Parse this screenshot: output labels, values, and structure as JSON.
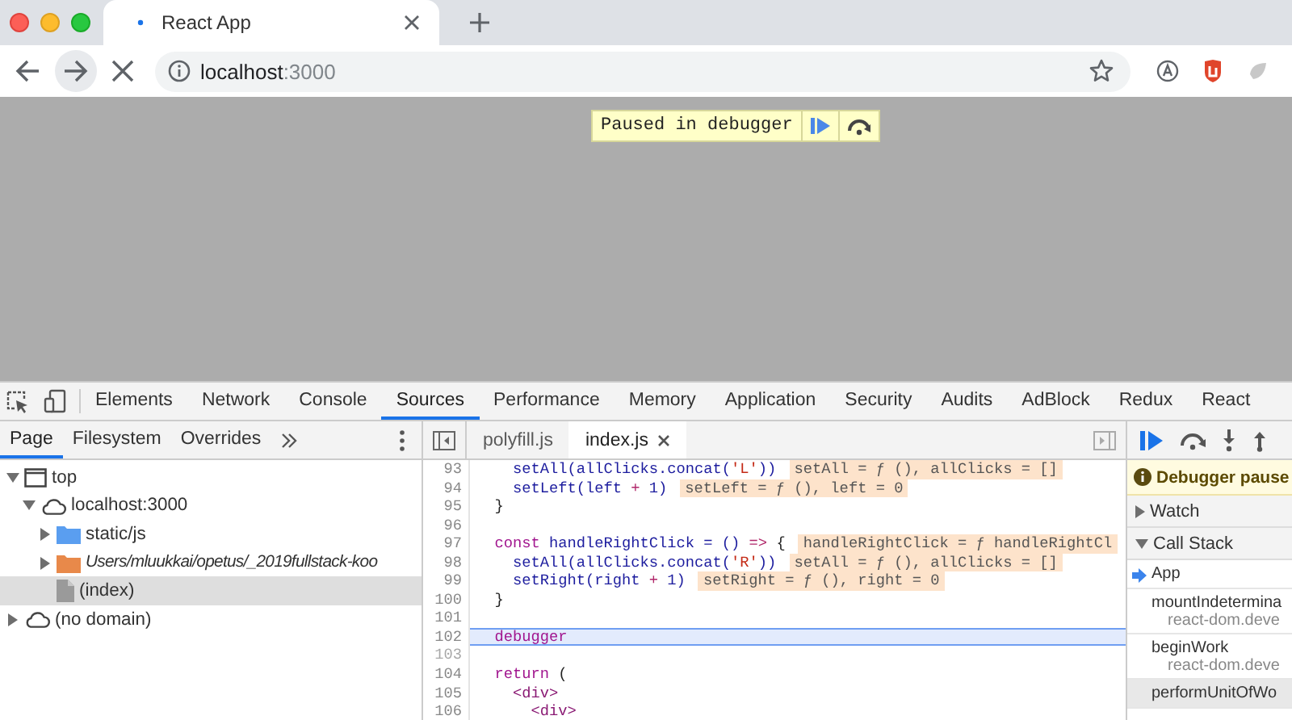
{
  "browser": {
    "tab": {
      "title": "React App"
    },
    "loading": true,
    "address": {
      "host": "localhost",
      "port": ":3000"
    }
  },
  "page": {
    "paused_banner": "Paused in debugger"
  },
  "devtools": {
    "tabs": [
      {
        "label": "Elements",
        "selected": false
      },
      {
        "label": "Network",
        "selected": false
      },
      {
        "label": "Console",
        "selected": false
      },
      {
        "label": "Sources",
        "selected": true
      },
      {
        "label": "Performance",
        "selected": false
      },
      {
        "label": "Memory",
        "selected": false
      },
      {
        "label": "Application",
        "selected": false
      },
      {
        "label": "Security",
        "selected": false
      },
      {
        "label": "Audits",
        "selected": false
      },
      {
        "label": "AdBlock",
        "selected": false
      },
      {
        "label": "Redux",
        "selected": false
      },
      {
        "label": "React",
        "selected": false
      }
    ],
    "navigator": {
      "tabs": [
        {
          "label": "Page",
          "selected": true
        },
        {
          "label": "Filesystem",
          "selected": false
        },
        {
          "label": "Overrides",
          "selected": false
        }
      ],
      "tree": [
        {
          "label": "top",
          "kind": "frame",
          "expanded": true,
          "italic": false,
          "selected": false,
          "children": [
            {
              "label": "localhost:3000",
              "kind": "domain",
              "expanded": true,
              "italic": false,
              "selected": false,
              "children": [
                {
                  "label": "static/js",
                  "kind": "folder",
                  "color": "#5a9ef0",
                  "expanded": false,
                  "italic": false,
                  "selected": false
                },
                {
                  "label": "Users/mluukkai/opetus/_2019fullstack-koo",
                  "kind": "folder",
                  "color": "#e8894a",
                  "expanded": false,
                  "italic": true,
                  "selected": false
                },
                {
                  "label": "(index)",
                  "kind": "file",
                  "italic": false,
                  "selected": true
                }
              ]
            }
          ]
        },
        {
          "label": "(no domain)",
          "kind": "domain",
          "expanded": false,
          "italic": false,
          "selected": false
        }
      ]
    },
    "editor": {
      "tabs": [
        {
          "label": "polyfill.js",
          "selected": false,
          "closable": false
        },
        {
          "label": "index.js",
          "selected": true,
          "closable": true
        }
      ],
      "lines": [
        {
          "number": "93",
          "executable": true,
          "current": false,
          "tokens": [
            {
              "text": "    setAll(allClicks.concat(",
              "kind": "plain"
            },
            {
              "text": "'L'",
              "kind": "string"
            },
            {
              "text": "))",
              "kind": "plain"
            }
          ],
          "value": "setAll = ƒ (), allClicks = []"
        },
        {
          "number": "94",
          "executable": true,
          "current": false,
          "tokens": [
            {
              "text": "    setLeft(left ",
              "kind": "plain"
            },
            {
              "text": "+",
              "kind": "operator"
            },
            {
              "text": " 1)",
              "kind": "plain"
            }
          ],
          "value": "setLeft = ƒ (), left = 0"
        },
        {
          "number": "95",
          "executable": true,
          "current": false,
          "tokens": [
            {
              "text": "  }",
              "kind": "punct"
            }
          ]
        },
        {
          "number": "96",
          "executable": true,
          "current": false
        },
        {
          "number": "97",
          "executable": true,
          "current": false,
          "tokens": [
            {
              "text": "  const",
              "kind": "keyword"
            },
            {
              "text": " handleRightClick = () ",
              "kind": "plain"
            },
            {
              "text": "=>",
              "kind": "operator"
            },
            {
              "text": " {",
              "kind": "punct"
            }
          ],
          "value": "handleRightClick = ƒ handleRightCl"
        },
        {
          "number": "98",
          "executable": true,
          "current": false,
          "tokens": [
            {
              "text": "    setAll(allClicks.concat(",
              "kind": "plain"
            },
            {
              "text": "'R'",
              "kind": "string"
            },
            {
              "text": "))",
              "kind": "plain"
            }
          ],
          "value": "setAll = ƒ (), allClicks = []"
        },
        {
          "number": "99",
          "executable": true,
          "current": false,
          "tokens": [
            {
              "text": "    setRight(right ",
              "kind": "plain"
            },
            {
              "text": "+",
              "kind": "operator"
            },
            {
              "text": " 1)",
              "kind": "plain"
            }
          ],
          "value": "setRight = ƒ (), right = 0"
        },
        {
          "number": "100",
          "executable": true,
          "current": false,
          "tokens": [
            {
              "text": "  }",
              "kind": "punct"
            }
          ]
        },
        {
          "number": "101",
          "executable": true,
          "current": false
        },
        {
          "number": "102",
          "executable": true,
          "current": true,
          "tokens": [
            {
              "text": "  debugger",
              "kind": "keyword"
            }
          ]
        },
        {
          "number": "103",
          "executable": false,
          "current": false
        },
        {
          "number": "104",
          "executable": true,
          "current": false,
          "tokens": [
            {
              "text": "  return",
              "kind": "keyword"
            },
            {
              "text": " (",
              "kind": "punct"
            }
          ]
        },
        {
          "number": "105",
          "executable": true,
          "current": false,
          "tokens": [
            {
              "text": "    <div>",
              "kind": "tag"
            }
          ]
        },
        {
          "number": "106",
          "executable": true,
          "current": false,
          "tokens": [
            {
              "text": "      <div>",
              "kind": "tag"
            }
          ]
        }
      ]
    },
    "debugger": {
      "status": "Debugger pause",
      "sections": [
        {
          "title": "Watch",
          "expanded": false
        },
        {
          "title": "Call Stack",
          "expanded": true
        }
      ],
      "call_stack": [
        {
          "name": "App",
          "selected": true,
          "hovered": false
        },
        {
          "name": "mountIndetermina",
          "location": "react-dom.deve",
          "selected": false,
          "hovered": false
        },
        {
          "name": "beginWork",
          "location": "react-dom.deve",
          "selected": false,
          "hovered": false
        },
        {
          "name": "performUnitOfWo",
          "selected": false,
          "hovered": true
        }
      ]
    }
  }
}
